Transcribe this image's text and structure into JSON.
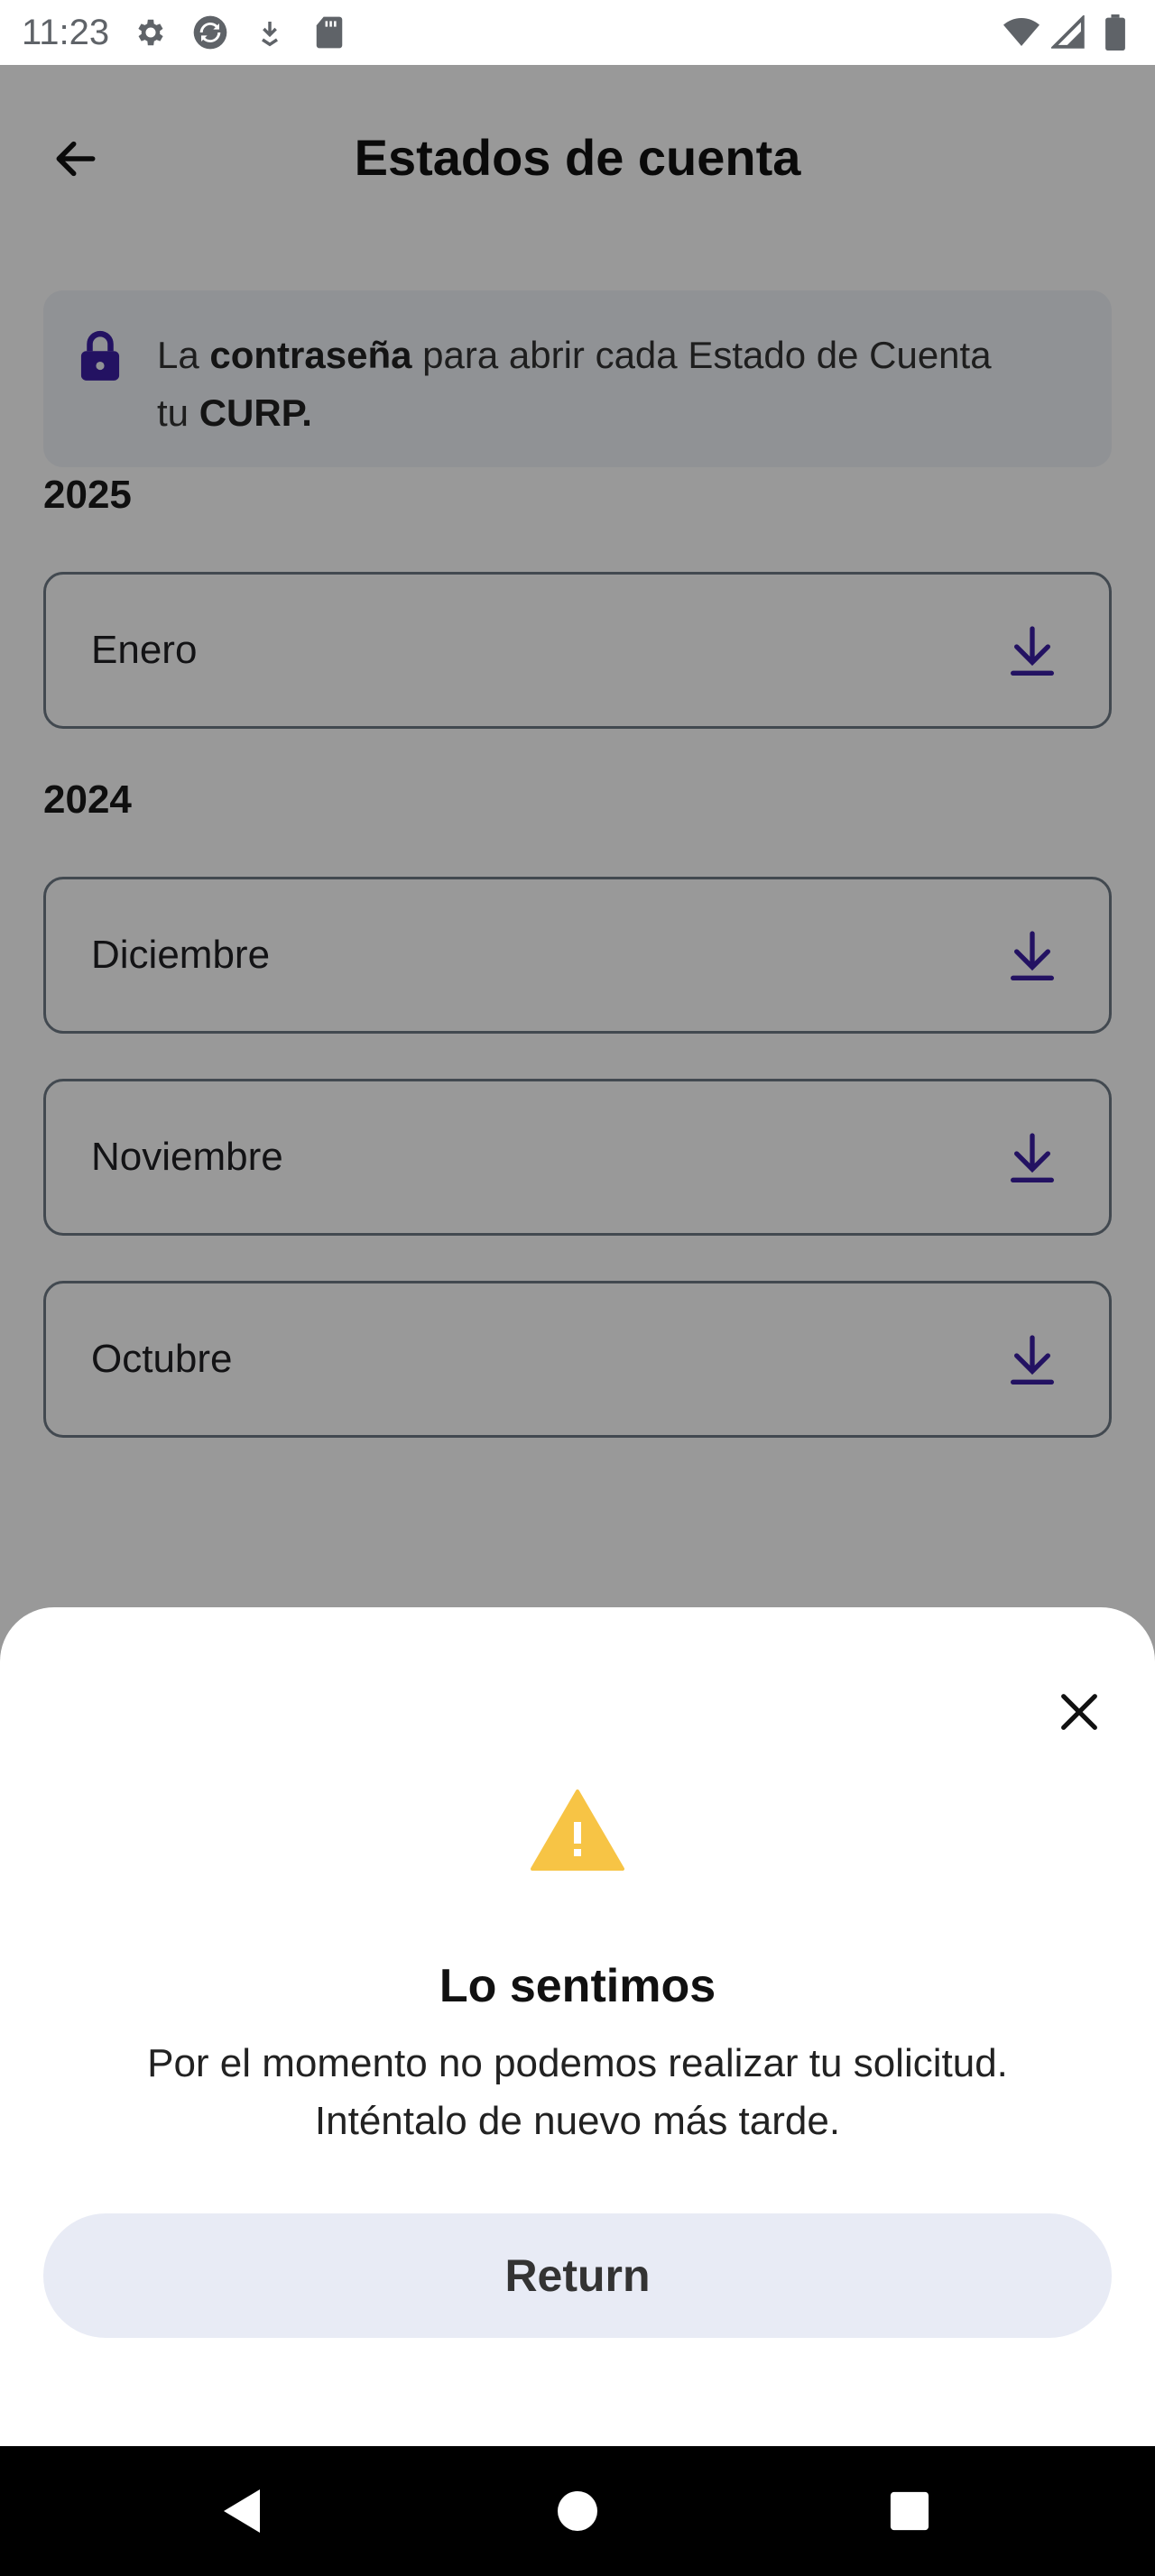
{
  "status_bar": {
    "time": "11:23",
    "left_icons": [
      "gear-icon",
      "sync-icon",
      "download-arrow-icon",
      "sd-card-icon"
    ],
    "right_icons": [
      "wifi-icon",
      "cell-signal-icon",
      "battery-icon"
    ]
  },
  "header": {
    "title": "Estados de cuenta",
    "back_icon": "arrow-left-icon"
  },
  "notice": {
    "icon": "lock-icon",
    "line1_prefix": "La ",
    "line1_bold": "contraseña",
    "line1_suffix": " para abrir cada Estado de Cuenta",
    "line2_prefix": "tu ",
    "line2_bold": "CURP."
  },
  "sections": [
    {
      "year": "2025",
      "months": [
        "Enero"
      ]
    },
    {
      "year": "2024",
      "months": [
        "Diciembre",
        "Noviembre",
        "Octubre"
      ]
    }
  ],
  "dialog": {
    "close_icon": "close-icon",
    "warning_icon": "warning-icon",
    "title": "Lo sentimos",
    "message_line1": "Por el momento no podemos realizar tu solicitud.",
    "message_line2": "Inténtalo de nuevo más tarde.",
    "button_label": "Return"
  },
  "nav_bar": {
    "buttons": [
      "back-triangle-icon",
      "home-circle-icon",
      "recents-square-icon"
    ]
  },
  "colors": {
    "accent": "#3b1fa3",
    "warning": "#f7c445",
    "button_bg": "#e8ebf5",
    "notice_bg": "#f1f3f8"
  }
}
